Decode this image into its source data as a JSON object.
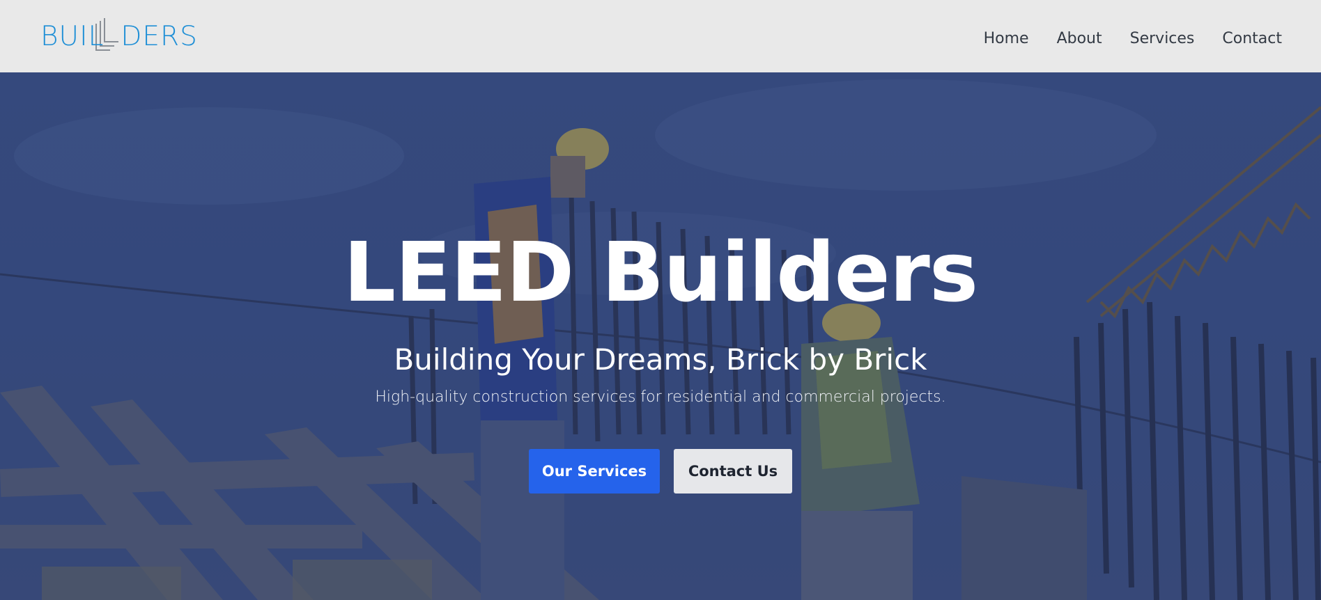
{
  "logo": {
    "text_left": "BUIL",
    "text_right": "DERS"
  },
  "nav": {
    "home": "Home",
    "about": "About",
    "services": "Services",
    "contact": "Contact"
  },
  "hero": {
    "title": "LEED Builders",
    "subtitle": "Building Your Dreams, Brick by Brick",
    "description": "High-quality construction services for residential and commercial projects.",
    "primary_button": "Our Services",
    "secondary_button": "Contact Us"
  },
  "colors": {
    "logo": "#1f8fd6",
    "primary": "#2563eb",
    "header_bg": "#e9e9e9",
    "overlay": "#3d4f7a"
  }
}
